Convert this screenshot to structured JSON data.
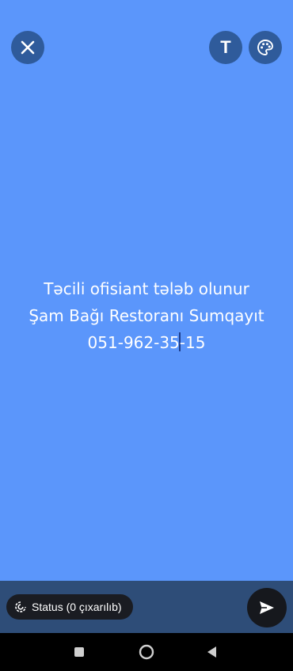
{
  "status_text": {
    "line1": "Təcili ofisiant tələb olunur",
    "line2": "Şam Bağı Restoranı Sumqayıt",
    "line3_before_caret": "051-962-35",
    "line3_after_caret": "-15"
  },
  "toolbar": {
    "text_button_glyph": "T",
    "close_icon": "close-icon",
    "palette_icon": "palette-icon"
  },
  "footer": {
    "status_pill_label": "Status (0 çıxarılıb)",
    "send_icon": "send-icon"
  },
  "system_nav": {
    "items": [
      "recents-icon",
      "home-icon",
      "back-icon"
    ]
  },
  "colors": {
    "canvas_background": "#5b96fb",
    "toolbar_button": "#2f5b9b",
    "bottom_bar": "#2e4d78",
    "pill": "#1a1c22",
    "text": "#ffffff"
  }
}
